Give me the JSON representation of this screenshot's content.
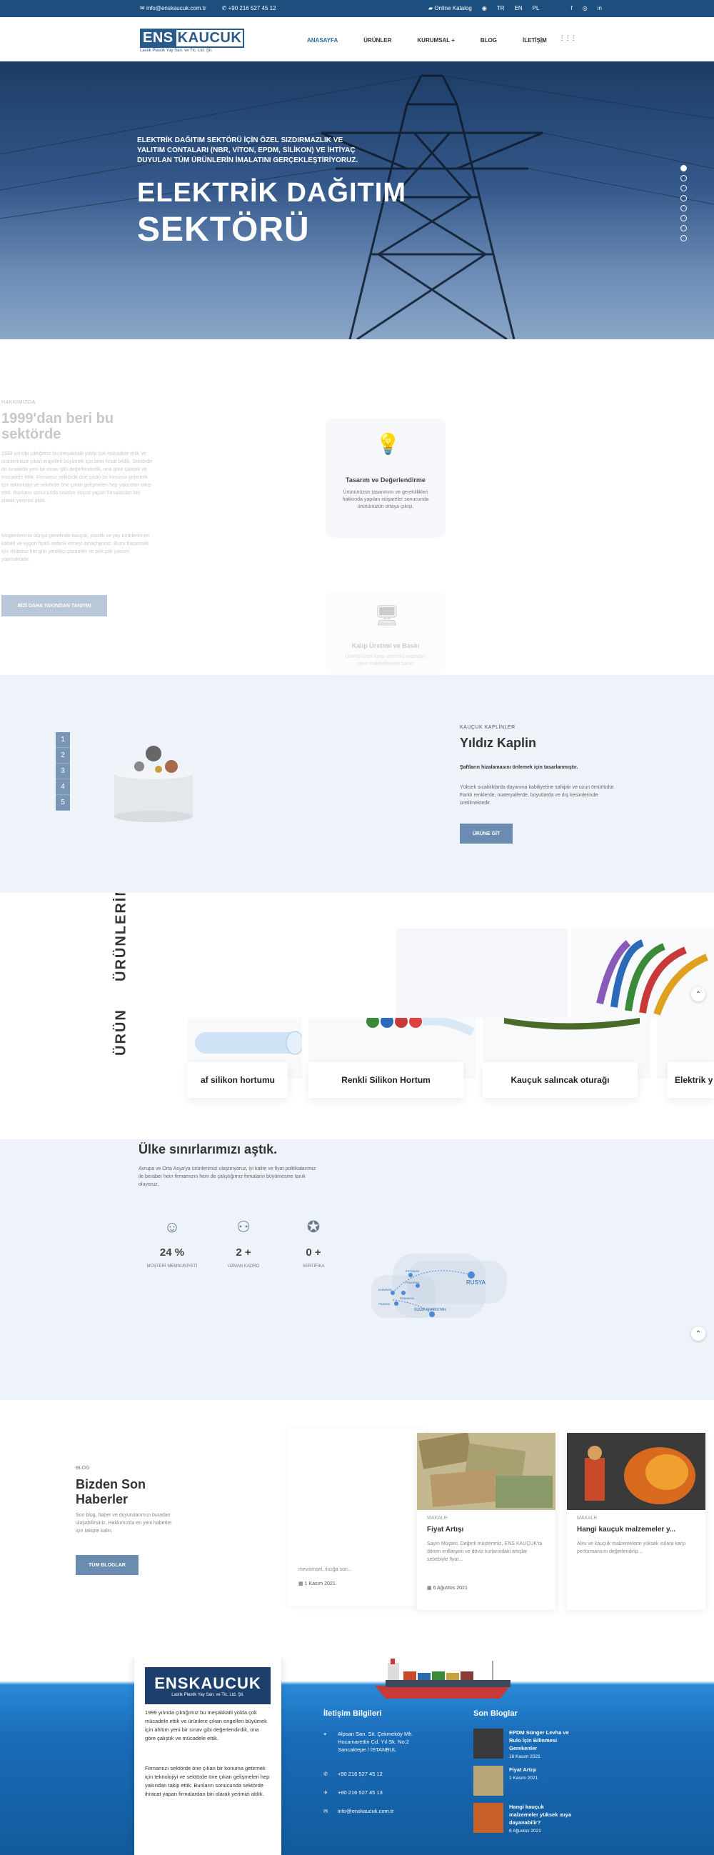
{
  "topbar": {
    "email": "info@enskaucuk.com.tr",
    "phone": "+90 216 527 45 12",
    "catalog": "Online Katalog",
    "lang_tr": "TR",
    "lang_en": "EN",
    "lang_pl": "PL",
    "social_fb": "f",
    "social_ig": "◎",
    "social_in": "in"
  },
  "header": {
    "logo_ens": "ENS",
    "logo_kaucuk": "KAUCUK",
    "logo_sub": "Lastik Plastik Yay San. ve Tic. Ltd. Şti.",
    "nav": [
      "ANASAYFA",
      "ÜRÜNLER",
      "KURUMSAL +",
      "BLOG",
      "İLETİŞİM"
    ]
  },
  "hero": {
    "subtitle": "ELEKTRİK DAĞITIM SEKTÖRÜ İÇİN ÖZEL SIZDIRMAZLIK VE YALITIM CONTALARI (NBR, VİTON, EPDM, SİLİKON) VE İHTİYAÇ DUYULAN TÜM ÜRÜNLERİN İMALATINI GERÇEKLEŞTİRİYORUZ.",
    "title_line1": "ELEKTRİK DAĞITIM",
    "title_line2": "SEKTÖRÜ",
    "slide_count": 8,
    "active_slide": 1
  },
  "about": {
    "kicker": "HAKKIMIZDA",
    "title": "1999'dan beri bu sektörde",
    "p1": "1999 yılında çıktığımız bu meşakkatli yolda çok mücadele ettik ve ürünlerimize çıkan engelleri büyümek için birer fırsat bildik. Sektörde ön sıralarda yeni bir sınav gibi değerlendirdik, ona göre çalıştık ve mücadele ettik. Firmamız sektörde öne çıkan bir konuma getirmek için teknolojiyi ve sektörde öne çıkan gelişmeleri hep yakından takip ettik. Bunların sonucunda sektöre itracat yapan firmalardan biri olarak yerimizi aldık.",
    "p2": "Müşterilerimiz dünya genelinde kauçuk, plastik ve yay ürünlerini en kaliteli ve uygun fiyatlı tedarik etmeyi amaçlıyoruz. Bunu başarmak için ekibimiz her gün yenilikçi çözümler ve pek çok yatırım yapmaktadır.",
    "button": "BİZİ DAHA YAKINDAN TANIYIN",
    "card1_title": "Tasarım ve Değerlendirme",
    "card1_desc": "Ürününüzün tasarımını ve gereklilikleri hakkında yapılan istişareler sonucunda ürününüzün ortaya çıkışı.",
    "card2_title": "Kalıp Üretimi ve Baskı",
    "card2_desc": "Ürününüzün kalıp üretimini ardından pres makinelerinde baskı"
  },
  "kaplin": {
    "steps": [
      "1",
      "2",
      "3",
      "4",
      "5"
    ],
    "kicker": "KAUÇUK KAPLİNLER",
    "title": "Yıldız Kaplin",
    "tagline": "Şaftların hizalamasını önlemek için tasarlanmıştır.",
    "desc": "Yüksek sıcaklıklarda dayanma kabiliyetine sahiptir ve uzun ömürlüdür. Farklı renklerde, materyallerde, boyutlarda ve dış kesimlerinde üretilmektedir.",
    "button": "ÜRÜNE GİT"
  },
  "products": {
    "vertical_label": "ÜRÜNLERİM",
    "vertical_label2": "ÜRÜN",
    "items": [
      "af silikon hortumu",
      "Renkli Silikon Hortum",
      "Kauçuk salıncak oturağı",
      "Elektrik y"
    ]
  },
  "global": {
    "title": "Ülke sınırlarımızı aştık.",
    "desc": "Avrupa ve Orta Asya'ya ürünlerimizi ulaştırıyoruz, iyi kalite ve fiyat politikalarımız ile beraber hem firmamızın hem de çalıştığımız firmaların büyümesine tanık oluyoruz.",
    "stats": [
      {
        "value": "24 %",
        "label": "MÜŞTERİ MEMNUNİYETİ",
        "icon": "smile-icon"
      },
      {
        "value": "2 +",
        "label": "UZMAN KADRO",
        "icon": "team-icon"
      },
      {
        "value": "0 +",
        "label": "SERTİFİKA",
        "icon": "award-icon"
      }
    ],
    "map_labels": [
      "RUSYA",
      "SUUDİ ARABİSTAN",
      "ESTONYA",
      "POLONYA",
      "ROMANYA",
      "ALMANYA",
      "FRANSA"
    ]
  },
  "blog": {
    "kicker": "BLOG",
    "title": "Bizden Son Haberler",
    "desc": "Son blog, haber ve duyurularımızı buradan ulaşabilirsiniz. Hakkımızda en yeni haberler için takipte kalın.",
    "button": "TÜM BLOGLAR",
    "cards": [
      {
        "cat": "",
        "title": "",
        "desc": "mevsimsel, ılıcığa son...",
        "date": "1 Kasım 2021"
      },
      {
        "cat": "MAKALE",
        "title": "Fiyat Artışı",
        "desc": "Sayın Müşteri, Değerli müşterimiz, ENS KAUÇUK'ta dönen enflasyon ve döviz kurlarındaki artışlar sebebiyle fiyat...",
        "date": "6 Ağustos 2021"
      },
      {
        "cat": "MAKALE",
        "title": "Hangi kauçuk malzemeler y...",
        "desc": "Alev ve kauçuk malzemelerin yüksek ısılara karşı performansını değerlendirip...",
        "date": ""
      }
    ]
  },
  "footer": {
    "logo_main": "ENSKAUCUK",
    "logo_sub": "Lastik Plastik Yay San. ve Tic. Ltd. Şti.",
    "p1": "1999 yılında çıktığımız bu meşakkatli yolda çok mücadele ettik ve ürünlere çıkan engelleri büyümek için ahlüm yeni bir sınav gibi değerlendirdik, ona göre çalıştık ve mücadele ettik.",
    "p2": "Firmamızı sektörde öne çıkan bir konuma getirmek için teknolojiyi ve sektörde öne çıkan gelişmeleri hep yakından takip ettik. Bunların sonucunda sektörde ihracat yapan firmalardan biri olarak yerimizi aldık.",
    "contact_title": "İletişim Bilgileri",
    "address": "Alpsan San. Sit. Çekmeköy Mh. Hocamarettin Cd. Yıl Sk. No:2 Sancaktepe / İSTANBUL",
    "phone1": "+90 216 527 45 12",
    "phone2": "+90 216 527 45 13",
    "email": "info@enskaucuk.com.tr",
    "blogs_title": "Son Bloglar",
    "recent": [
      {
        "title": "EPDM Sünger Levha ve Rulo İçin Bilinmesi Gerekenler",
        "date": "16 Kasım 2021"
      },
      {
        "title": "Fiyat Artışı",
        "date": "1 Kasım 2021"
      },
      {
        "title": "Hangi kauçuk malzemeler yüksek ısıya dayanabilir?",
        "date": "6 Ağustos 2021"
      }
    ]
  },
  "colors": {
    "brand": "#1d4f7e",
    "accent": "#2a6aa8",
    "button": "#6a8cb0",
    "light_bg": "#eef3fa"
  }
}
